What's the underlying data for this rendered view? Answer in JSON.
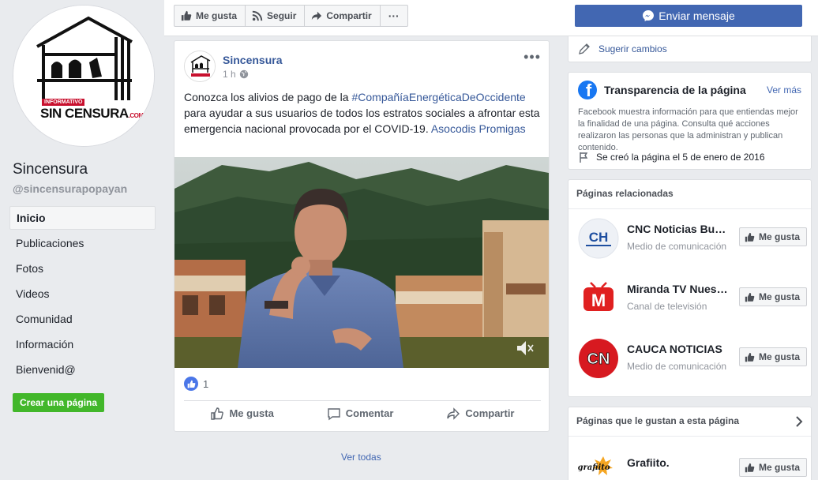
{
  "page": {
    "name": "Sincensura",
    "handle": "@sincensurapopayan",
    "logo_text_top": "INFORMATIVO",
    "logo_text_main": "SIN CENSURA",
    "logo_text_suffix": ".COM"
  },
  "nav": {
    "items": [
      "Inicio",
      "Publicaciones",
      "Fotos",
      "Videos",
      "Comunidad",
      "Información",
      "Bienvenid@"
    ],
    "create_page": "Crear una página"
  },
  "topbar": {
    "like": "Me gusta",
    "follow": "Seguir",
    "share": "Compartir",
    "more": "···",
    "message": "Enviar mensaje"
  },
  "post": {
    "author": "Sincensura",
    "time": "1 h",
    "more": "•••",
    "text_before": "Conozca los alivios de pago de la ",
    "hashtag": "#CompañíaEnergéticaDeOccidente",
    "text_after": " para ayudar a sus usuarios de todos los estratos sociales a afrontar esta emergencia nacional provocada por el COVID-19. ",
    "mention": "Asocodis Promigas",
    "reaction_count": "1",
    "actions": {
      "like": "Me gusta",
      "comment": "Comentar",
      "share": "Compartir"
    }
  },
  "ver_todas": "Ver todas",
  "right": {
    "suggest": "Sugerir cambios",
    "transparency": {
      "title": "Transparencia de la página",
      "more": "Ver más",
      "desc": "Facebook muestra información para que entiendas mejor la finalidad de una página. Consulta qué acciones realizaron las personas que la administran y publican contenido.",
      "created": "Se creó la página el 5 de enero de 2016"
    },
    "related": {
      "title": "Páginas relacionadas",
      "items": [
        {
          "name": "CNC Noticias Buenaventura",
          "sub": "Medio de comunicación",
          "button": "Me gusta",
          "logo_text": "CH"
        },
        {
          "name": "Miranda TV Nuestro Canal",
          "sub": "Canal de televisión",
          "button": "Me gusta",
          "logo_text": "M"
        },
        {
          "name": "CAUCA NOTICIAS",
          "sub": "Medio de comunicación",
          "button": "Me gusta",
          "logo_text": "CN"
        }
      ]
    },
    "liked": {
      "title": "Páginas que le gustan a esta página",
      "items": [
        {
          "name": "Grafiito.",
          "button": "Me gusta",
          "logo_text": "grafiito"
        }
      ]
    }
  },
  "colors": {
    "brand_blue": "#4267b2",
    "link_blue": "#365899",
    "green": "#42b72a",
    "background": "#e9ebee"
  }
}
